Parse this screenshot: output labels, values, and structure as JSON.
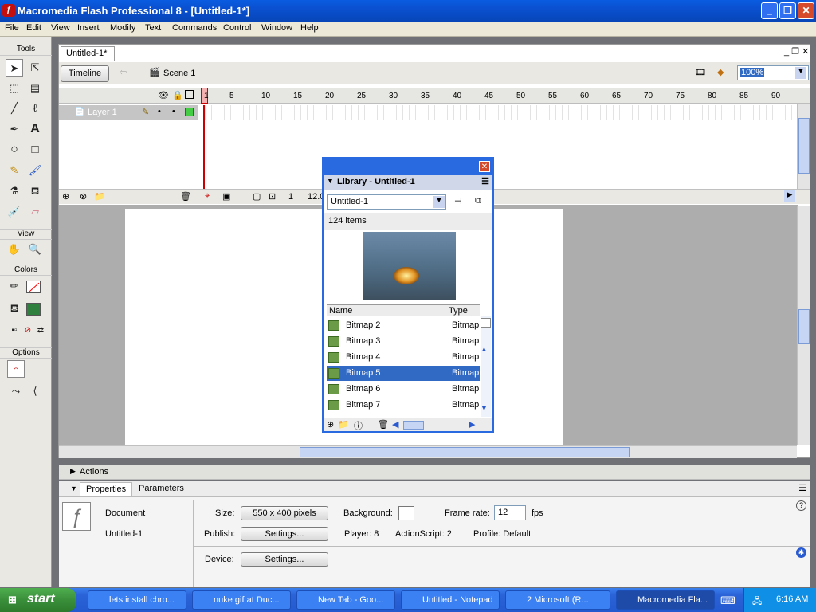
{
  "window": {
    "title": "Macromedia Flash Professional 8 - [Untitled-1*]",
    "app_icon": "flash-icon",
    "controls": [
      "minimize",
      "restore",
      "close"
    ]
  },
  "menubar": [
    "File",
    "Edit",
    "View",
    "Insert",
    "Modify",
    "Text",
    "Commands",
    "Control",
    "Window",
    "Help"
  ],
  "tools_panel": {
    "title": "Tools",
    "view_label": "View",
    "colors_label": "Colors",
    "options_label": "Options",
    "stroke_color": "#ffffff",
    "fill_color": "#2f7f3f"
  },
  "document": {
    "tab": "Untitled-1*",
    "timeline_button": "Timeline",
    "scene": "Scene 1",
    "zoom": "100%"
  },
  "timeline": {
    "layer": "Layer 1",
    "frame_numbers": [
      "1",
      "5",
      "10",
      "15",
      "20",
      "25",
      "30",
      "35",
      "40",
      "45",
      "50",
      "55",
      "60",
      "65",
      "70",
      "75",
      "80",
      "85",
      "90"
    ],
    "current_frame": "1",
    "fps": "12.0"
  },
  "library": {
    "title": "Library - Untitled-1",
    "selector": "Untitled-1",
    "count": "124 items",
    "col_name": "Name",
    "col_type": "Type",
    "items": [
      {
        "name": "Bitmap 2",
        "type": "Bitmap"
      },
      {
        "name": "Bitmap 3",
        "type": "Bitmap"
      },
      {
        "name": "Bitmap 4",
        "type": "Bitmap"
      },
      {
        "name": "Bitmap 5",
        "type": "Bitmap",
        "selected": true
      },
      {
        "name": "Bitmap 6",
        "type": "Bitmap"
      },
      {
        "name": "Bitmap 7",
        "type": "Bitmap"
      }
    ]
  },
  "actions_panel": {
    "title": "Actions"
  },
  "properties": {
    "tab_properties": "Properties",
    "tab_parameters": "Parameters",
    "doc_type": "Document",
    "doc_name": "Untitled-1",
    "size_label": "Size:",
    "size_value": "550 x 400 pixels",
    "background_label": "Background:",
    "framerate_label": "Frame rate:",
    "framerate_value": "12",
    "fps_unit": "fps",
    "publish_label": "Publish:",
    "settings_label": "Settings...",
    "player_text": "Player: 8",
    "actionscript_text": "ActionScript:  2",
    "profile_text": "Profile:  Default",
    "device_label": "Device:"
  },
  "taskbar": {
    "start": "start",
    "tasks": [
      "lets install chro...",
      "nuke gif at Duc...",
      "New Tab - Goo...",
      "Untitled - Notepad",
      "2 Microsoft (R...",
      "Macromedia Fla..."
    ],
    "clock": "6:16 AM"
  }
}
